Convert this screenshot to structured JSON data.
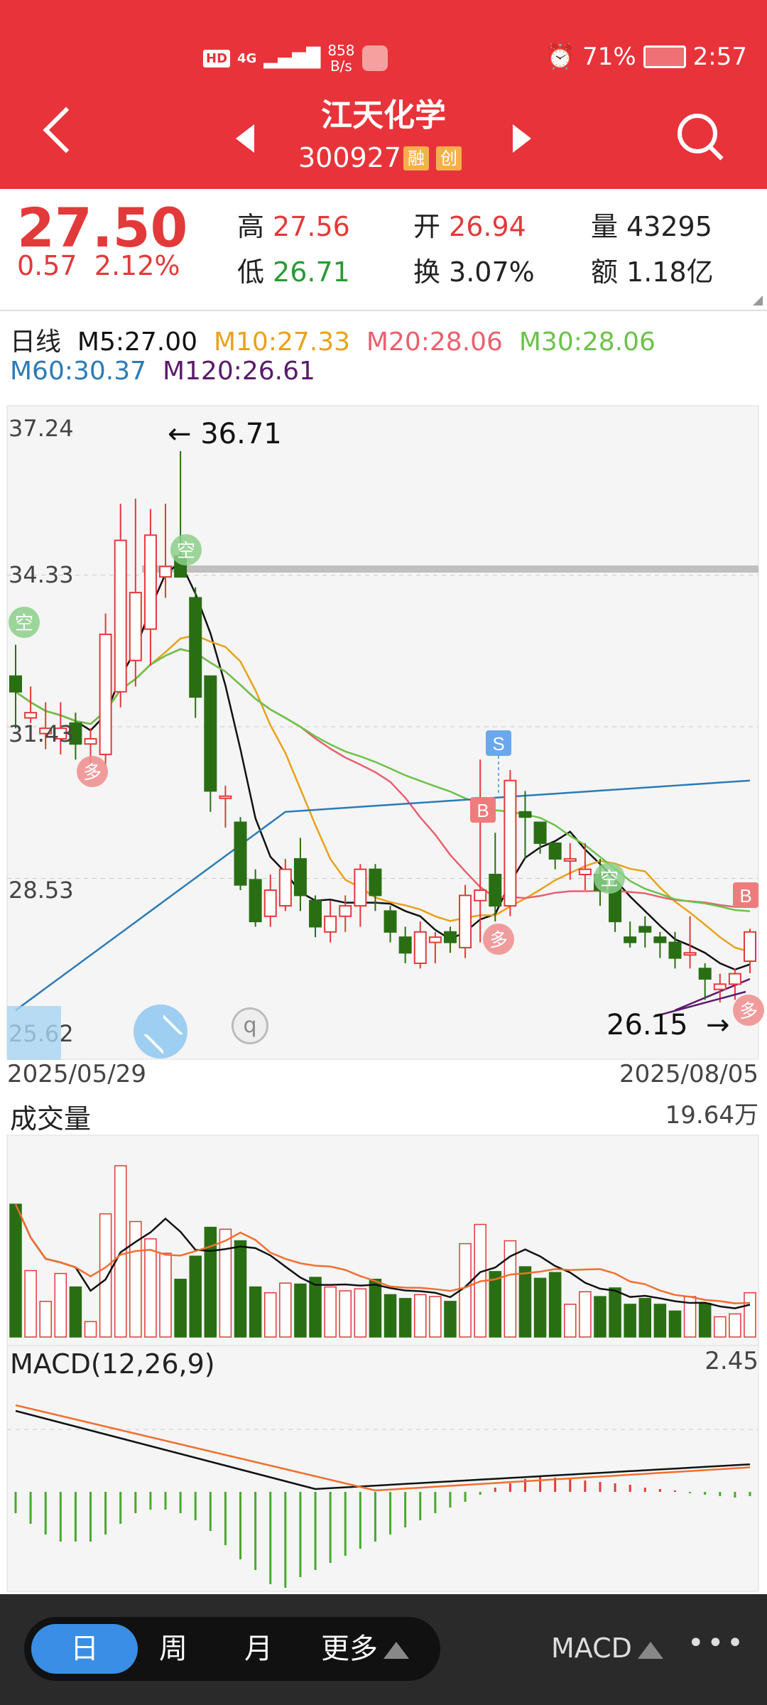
{
  "status": {
    "hd": "HD",
    "net": "4G",
    "speed_value": "858",
    "speed_unit": "B/s",
    "battery": "71%",
    "time": "2:57"
  },
  "stock": {
    "name": "江天化学",
    "code": "300927",
    "tags": [
      "融",
      "创"
    ]
  },
  "quote": {
    "price": "27.50",
    "change": "0.57",
    "change_pct": "2.12%",
    "high_label": "高",
    "high": "27.56",
    "low_label": "低",
    "low": "26.71",
    "open_label": "开",
    "open": "26.94",
    "turnover_label": "换",
    "turnover": "3.07%",
    "volume_label": "量",
    "volume": "43295",
    "amount_label": "额",
    "amount": "1.18亿"
  },
  "ma": {
    "period": "日线",
    "m5": "M5:27.00",
    "m10": "M10:27.33",
    "m20": "M20:28.06",
    "m30": "M30:28.06",
    "m60": "M60:30.37",
    "m120": "M120:26.61"
  },
  "colors": {
    "red": "#e23a3a",
    "green": "#2a6e14",
    "m5": "#111111",
    "m10": "#e8a21a",
    "m20": "#e86070",
    "m30": "#6cc24a",
    "m60": "#2c7bb6",
    "m120": "#5a1a6a"
  },
  "main_chart": {
    "y_labels": [
      "37.24",
      "34.33",
      "31.43",
      "28.53",
      "25.62"
    ],
    "high_marker": "36.71",
    "low_marker": "26.15",
    "date_start": "2025/05/29",
    "date_end": "2025/08/05",
    "signals": {
      "s": "S",
      "b": "B",
      "duo": "多",
      "kong": "空"
    },
    "zoom_icon": "expand-icon",
    "info_icon": "q"
  },
  "volume_chart": {
    "title": "成交量",
    "max_label": "19.64万"
  },
  "macd_chart": {
    "title": "MACD(12,26,9)",
    "max_label": "2.45"
  },
  "bottom_bar": {
    "tabs": [
      "日",
      "周",
      "月",
      "更多"
    ],
    "indicator": "MACD",
    "more": "•••"
  },
  "chart_data": {
    "type": "candlestick",
    "candles": [
      [
        32.4,
        32.1,
        33.0,
        31.4
      ],
      [
        31.6,
        31.7,
        32.2,
        31.5
      ],
      [
        31.3,
        31.4,
        31.9,
        31.0
      ],
      [
        31.2,
        31.4,
        31.9,
        30.9
      ],
      [
        31.5,
        31.1,
        31.7,
        30.8
      ],
      [
        31.1,
        31.2,
        31.4,
        30.6
      ],
      [
        30.9,
        33.2,
        33.6,
        30.7
      ],
      [
        32.1,
        35.0,
        35.7,
        31.8
      ],
      [
        32.7,
        34.0,
        35.8,
        32.2
      ],
      [
        33.3,
        35.1,
        35.6,
        32.6
      ],
      [
        34.3,
        34.5,
        35.7,
        33.9
      ],
      [
        34.7,
        34.3,
        36.71,
        34.3
      ],
      [
        33.9,
        32.0,
        34.1,
        31.6
      ],
      [
        32.4,
        30.2,
        32.4,
        29.8
      ],
      [
        30.1,
        30.1,
        30.3,
        29.5
      ],
      [
        29.6,
        28.4,
        29.7,
        28.3
      ],
      [
        28.5,
        27.7,
        28.7,
        27.6
      ],
      [
        27.8,
        28.3,
        28.6,
        27.6
      ],
      [
        28.0,
        28.7,
        28.9,
        27.9
      ],
      [
        28.9,
        28.2,
        29.3,
        27.9
      ],
      [
        28.1,
        27.6,
        28.2,
        27.4
      ],
      [
        27.5,
        27.8,
        28.1,
        27.3
      ],
      [
        27.8,
        28.0,
        28.2,
        27.5
      ],
      [
        28.0,
        28.7,
        28.8,
        27.6
      ],
      [
        28.7,
        28.2,
        28.8,
        27.9
      ],
      [
        27.9,
        27.5,
        28.0,
        27.3
      ],
      [
        27.4,
        27.1,
        27.6,
        26.9
      ],
      [
        26.9,
        27.5,
        27.7,
        26.8
      ],
      [
        27.3,
        27.4,
        27.5,
        26.9
      ],
      [
        27.5,
        27.3,
        27.6,
        27.1
      ],
      [
        27.2,
        28.2,
        28.4,
        27.0
      ],
      [
        28.1,
        28.3,
        30.8,
        27.3
      ],
      [
        28.6,
        28.0,
        29.4,
        27.7
      ],
      [
        28.0,
        30.4,
        30.6,
        27.8
      ],
      [
        29.8,
        29.7,
        30.2,
        28.9
      ],
      [
        29.6,
        29.2,
        29.6,
        29.0
      ],
      [
        29.2,
        28.9,
        29.2,
        28.7
      ],
      [
        28.9,
        28.9,
        29.2,
        28.5
      ],
      [
        28.6,
        28.7,
        29.2,
        28.3
      ],
      [
        28.6,
        28.3,
        28.9,
        28.0
      ],
      [
        28.4,
        27.7,
        28.6,
        27.5
      ],
      [
        27.4,
        27.3,
        27.7,
        27.2
      ],
      [
        27.6,
        27.5,
        27.8,
        27.2
      ],
      [
        27.4,
        27.3,
        27.5,
        27.0
      ],
      [
        27.3,
        27.0,
        27.5,
        26.8
      ],
      [
        27.1,
        27.1,
        27.8,
        26.8
      ],
      [
        26.8,
        26.6,
        26.9,
        26.2
      ],
      [
        26.4,
        26.5,
        26.7,
        26.15
      ],
      [
        26.5,
        26.7,
        26.8,
        26.2
      ],
      [
        26.94,
        27.5,
        27.56,
        26.71
      ]
    ],
    "volume": [
      138,
      69,
      37,
      66,
      52,
      16,
      128,
      178,
      120,
      102,
      87,
      60,
      84,
      114,
      112,
      100,
      52,
      46,
      56,
      55,
      62,
      52,
      48,
      50,
      60,
      44,
      40,
      44,
      42,
      37,
      97,
      117,
      68,
      100,
      73,
      61,
      67,
      34,
      47,
      42,
      51,
      34,
      40,
      34,
      27,
      42,
      35,
      21,
      24,
      46
    ],
    "ylim": [
      25.62,
      37.24
    ]
  }
}
